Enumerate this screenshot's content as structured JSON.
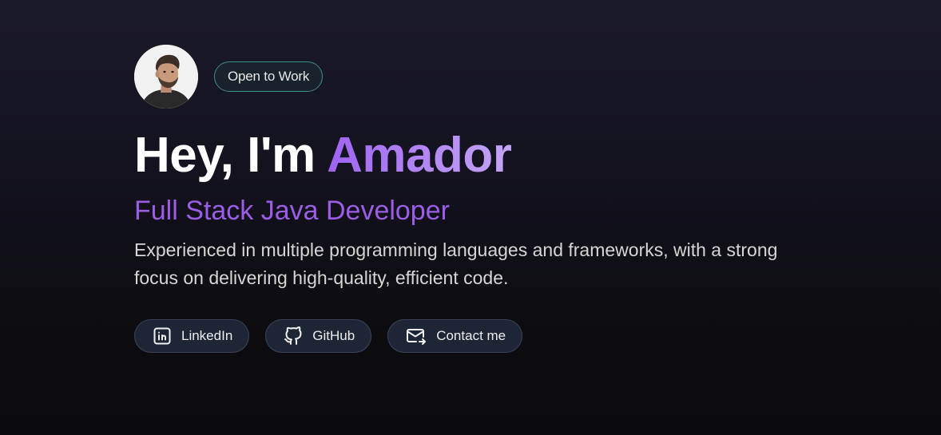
{
  "hero": {
    "badge": "Open to Work",
    "greeting": "Hey, I'm",
    "name": "Amador",
    "role": "Full Stack Java Developer",
    "description": "Experienced in multiple programming languages and frameworks, with a strong focus on delivering high-quality, efficient code."
  },
  "actions": [
    {
      "label": "LinkedIn",
      "icon": "linkedin-icon"
    },
    {
      "label": "GitHub",
      "icon": "github-icon"
    },
    {
      "label": "Contact me",
      "icon": "mail-icon"
    }
  ],
  "colors": {
    "accent": "#9b5de5",
    "badge_border": "#3f8f82",
    "button_bg": "#1e2636"
  }
}
